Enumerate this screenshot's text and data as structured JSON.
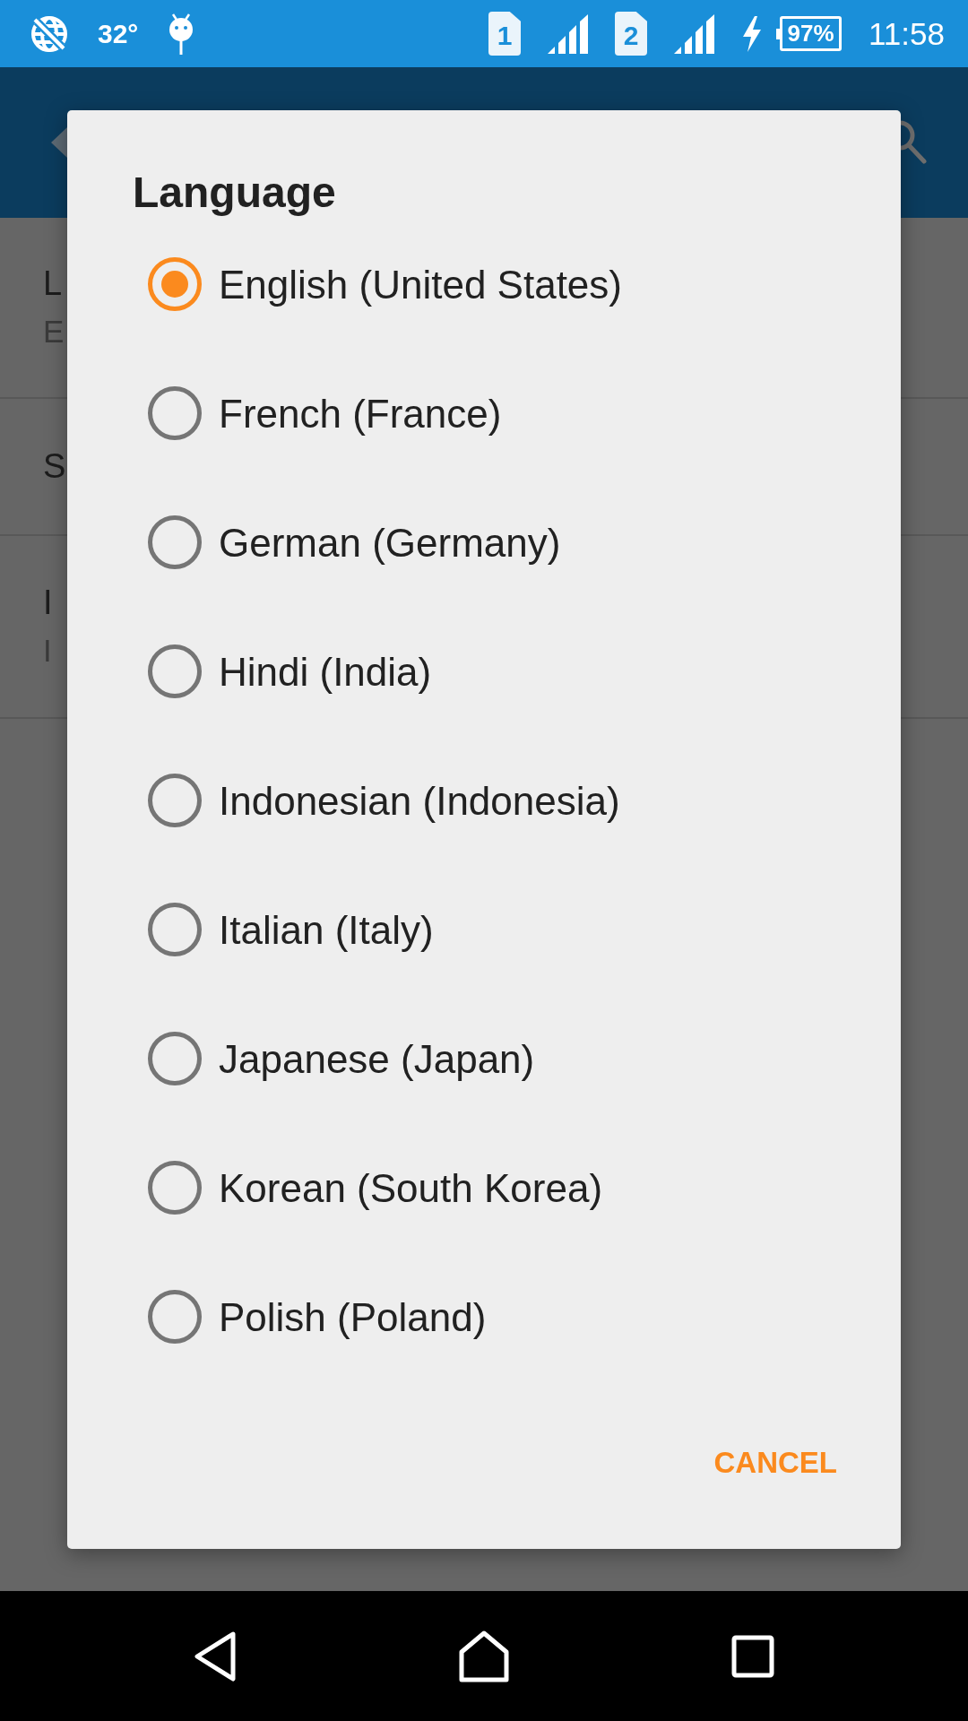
{
  "status_bar": {
    "temperature": "32°",
    "sims": [
      "1",
      "2"
    ],
    "charging": true,
    "battery": "97%",
    "time": "11:58"
  },
  "settings_list": {
    "rows": [
      {
        "title": "L",
        "subtitle": "E"
      },
      {
        "title": "S"
      },
      {
        "title": "I",
        "subtitle": "I"
      }
    ]
  },
  "dialog": {
    "title": "Language",
    "options": [
      {
        "label": "English (United States)",
        "selected": true
      },
      {
        "label": "French (France)",
        "selected": false
      },
      {
        "label": "German (Germany)",
        "selected": false
      },
      {
        "label": "Hindi (India)",
        "selected": false
      },
      {
        "label": "Indonesian (Indonesia)",
        "selected": false
      },
      {
        "label": "Italian (Italy)",
        "selected": false
      },
      {
        "label": "Japanese (Japan)",
        "selected": false
      },
      {
        "label": "Korean (South Korea)",
        "selected": false
      },
      {
        "label": "Polish (Poland)",
        "selected": false
      }
    ],
    "buttons": [
      "CANCEL"
    ]
  }
}
